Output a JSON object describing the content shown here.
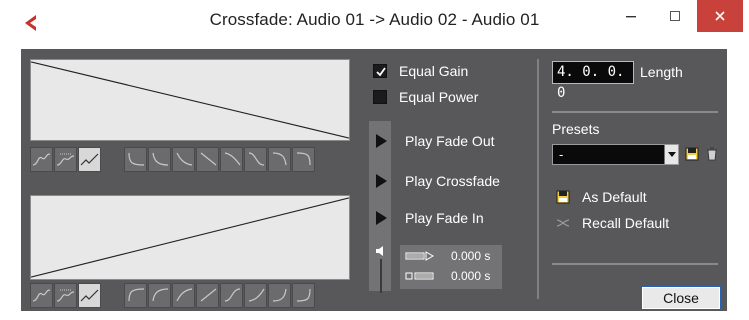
{
  "window": {
    "title": "Crossfade: Audio 01 -> Audio 02 - Audio 01",
    "minimize_icon": "minimize-icon",
    "maximize_icon": "maximize-icon",
    "close_icon": "close-icon",
    "app_icon": "cubase-logo-icon"
  },
  "options": {
    "equal_gain_label": "Equal Gain",
    "equal_gain_checked": true,
    "equal_power_label": "Equal Power",
    "equal_power_checked": false
  },
  "playback": {
    "play_fade_out": "Play Fade Out",
    "play_crossfade": "Play Crossfade",
    "play_fade_in": "Play Fade In",
    "pre_roll_time": "0.000 s",
    "post_roll_time": "0.000 s"
  },
  "length": {
    "value": "4. 0. 0.  0",
    "label": "Length"
  },
  "presets": {
    "label": "Presets",
    "selected": "-",
    "as_default_label": "As Default",
    "recall_default_label": "Recall Default"
  },
  "footer": {
    "close_label": "Close"
  },
  "colors": {
    "panel": "#58585a",
    "curve_bg": "#e8e8e8",
    "close_button": "#c8413a"
  }
}
